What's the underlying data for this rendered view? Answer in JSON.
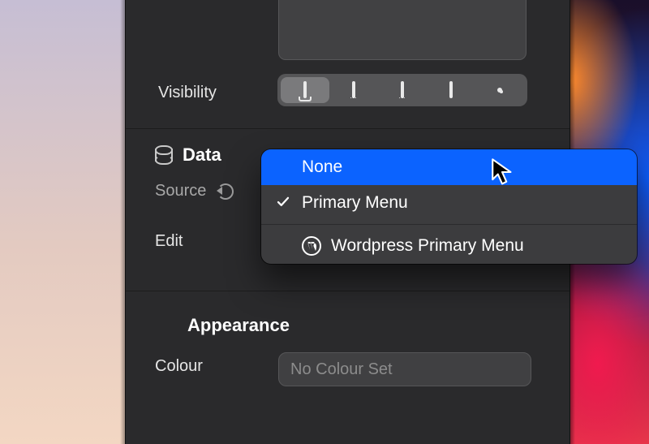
{
  "visibility": {
    "label": "Visibility",
    "selectedIndex": 0
  },
  "data": {
    "title": "Data",
    "sourceLabel": "Source",
    "editLabel": "Edit"
  },
  "appearance": {
    "title": "Appearance",
    "colourLabel": "Colour",
    "colourPlaceholder": "No Colour Set"
  },
  "dropdown": {
    "highlightedIndex": 0,
    "selectedIndex": 1,
    "items": [
      {
        "label": "None"
      },
      {
        "label": "Primary Menu"
      },
      {
        "label": "Wordpress Primary Menu",
        "icon": "wordpress"
      }
    ]
  }
}
